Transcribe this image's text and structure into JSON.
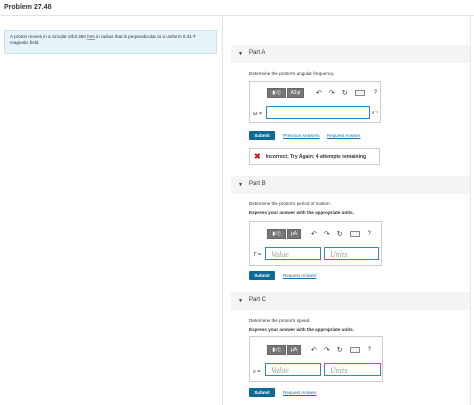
{
  "header": {
    "title": "Problem 27.48"
  },
  "problem": {
    "text_before": "A proton moves in a circular orbit 350 ",
    "unit_mm": "mm",
    "text_after": " in radius that is perpendicular to a uniform 0.31-T magnetic field."
  },
  "parts": [
    {
      "label": "Part A",
      "question": "Determine the proton's angular frequency.",
      "variable": "ω =",
      "unit_suffix": "s⁻¹",
      "input_value": "",
      "submit_label": "Submit",
      "link1": "Previous Answers",
      "link2": "Request Answer",
      "feedback": "Incorrect; Try Again; 4 attempts remaining"
    },
    {
      "label": "Part B",
      "question": "Determine the proton's period of motion.",
      "instruction": "Express your answer with the appropriate units.",
      "variable": "T =",
      "value_placeholder": "Value",
      "units_placeholder": "Units",
      "submit_label": "Submit",
      "link1": "Request Answer"
    },
    {
      "label": "Part C",
      "question": "Determine the proton's speed.",
      "instruction": "Express your answer with the appropriate units.",
      "variable": "v =",
      "value_placeholder": "Value",
      "units_placeholder": "Units",
      "submit_label": "Submit",
      "link1": "Request Answer"
    }
  ],
  "toolbar": {
    "templates_label": "▮√▯",
    "symbols_label": "ΑΣφ",
    "units_label": "μA",
    "help_label": "?"
  },
  "icons": {
    "undo": "undo-icon",
    "redo": "redo-icon",
    "reset": "reset-icon",
    "keyboard": "keyboard-icon",
    "help": "help-icon",
    "expand": "triangle-down-icon",
    "incorrect": "x-icon"
  },
  "colors": {
    "submit": "#0a6b95",
    "link": "#1a6fa8",
    "input_border": "#2a8bc5",
    "problem_bg": "#e6f3f8",
    "incorrect": "#c81e1e"
  }
}
